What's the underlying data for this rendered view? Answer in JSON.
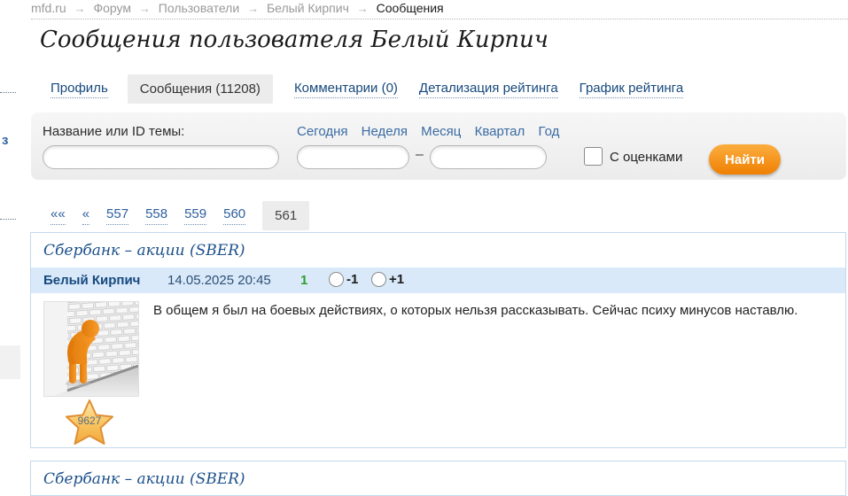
{
  "breadcrumb": {
    "separator": "→",
    "items": [
      "mfd.ru",
      "Форум",
      "Пользователи",
      "Белый Кирпич"
    ],
    "current": "Сообщения"
  },
  "page": {
    "title": "Сообщения пользователя Белый Кирпич"
  },
  "tabs": {
    "items": [
      {
        "label": "Профиль",
        "active": false
      },
      {
        "label": "Сообщения (11208)",
        "active": true
      },
      {
        "label": "Комментарии (0)",
        "active": false
      },
      {
        "label": "Детализация рейтинга",
        "active": false
      },
      {
        "label": "График рейтинга",
        "active": false
      }
    ]
  },
  "search_form": {
    "topic_label": "Название или ID темы:",
    "topic_value": "",
    "date_links": [
      "Сегодня",
      "Неделя",
      "Месяц",
      "Квартал",
      "Год"
    ],
    "date_from_value": "",
    "date_to_value": "",
    "range_dash": "–",
    "with_ratings_label": "С оценками",
    "with_ratings_checked": false,
    "find_button_label": "Найти"
  },
  "pagination": {
    "items": [
      "««",
      "«",
      "557",
      "558",
      "559",
      "560"
    ],
    "current": "561"
  },
  "messages": [
    {
      "topic": "Сбербанк – акции (SBER)",
      "author": "Белый Кирпич",
      "datetime": "14.05.2025 20:45",
      "rating": "1",
      "vote_down_label": "-1",
      "vote_up_label": "+1",
      "star_value": "9627",
      "avatar_description": "orange-figure-leaning-head-on-white-brick-wall",
      "text": "В общем я был на боевых действиях, о которых нельзя рассказывать. Сейчас психу минусов наставлю."
    },
    {
      "topic": "Сбербанк – акции (SBER)"
    }
  ],
  "left_edge": {
    "fragment_text": "з"
  },
  "colors": {
    "accent_orange": "#ef7f02",
    "link_blue": "#2d5f9e",
    "tab_navy": "#17497c",
    "date_link_blue": "#3a6ba3",
    "rating_green": "#2f9e2f",
    "author_row_bg": "#d9e9f9",
    "block_border": "#c3d9ec",
    "active_tab_bg": "#ececec"
  }
}
